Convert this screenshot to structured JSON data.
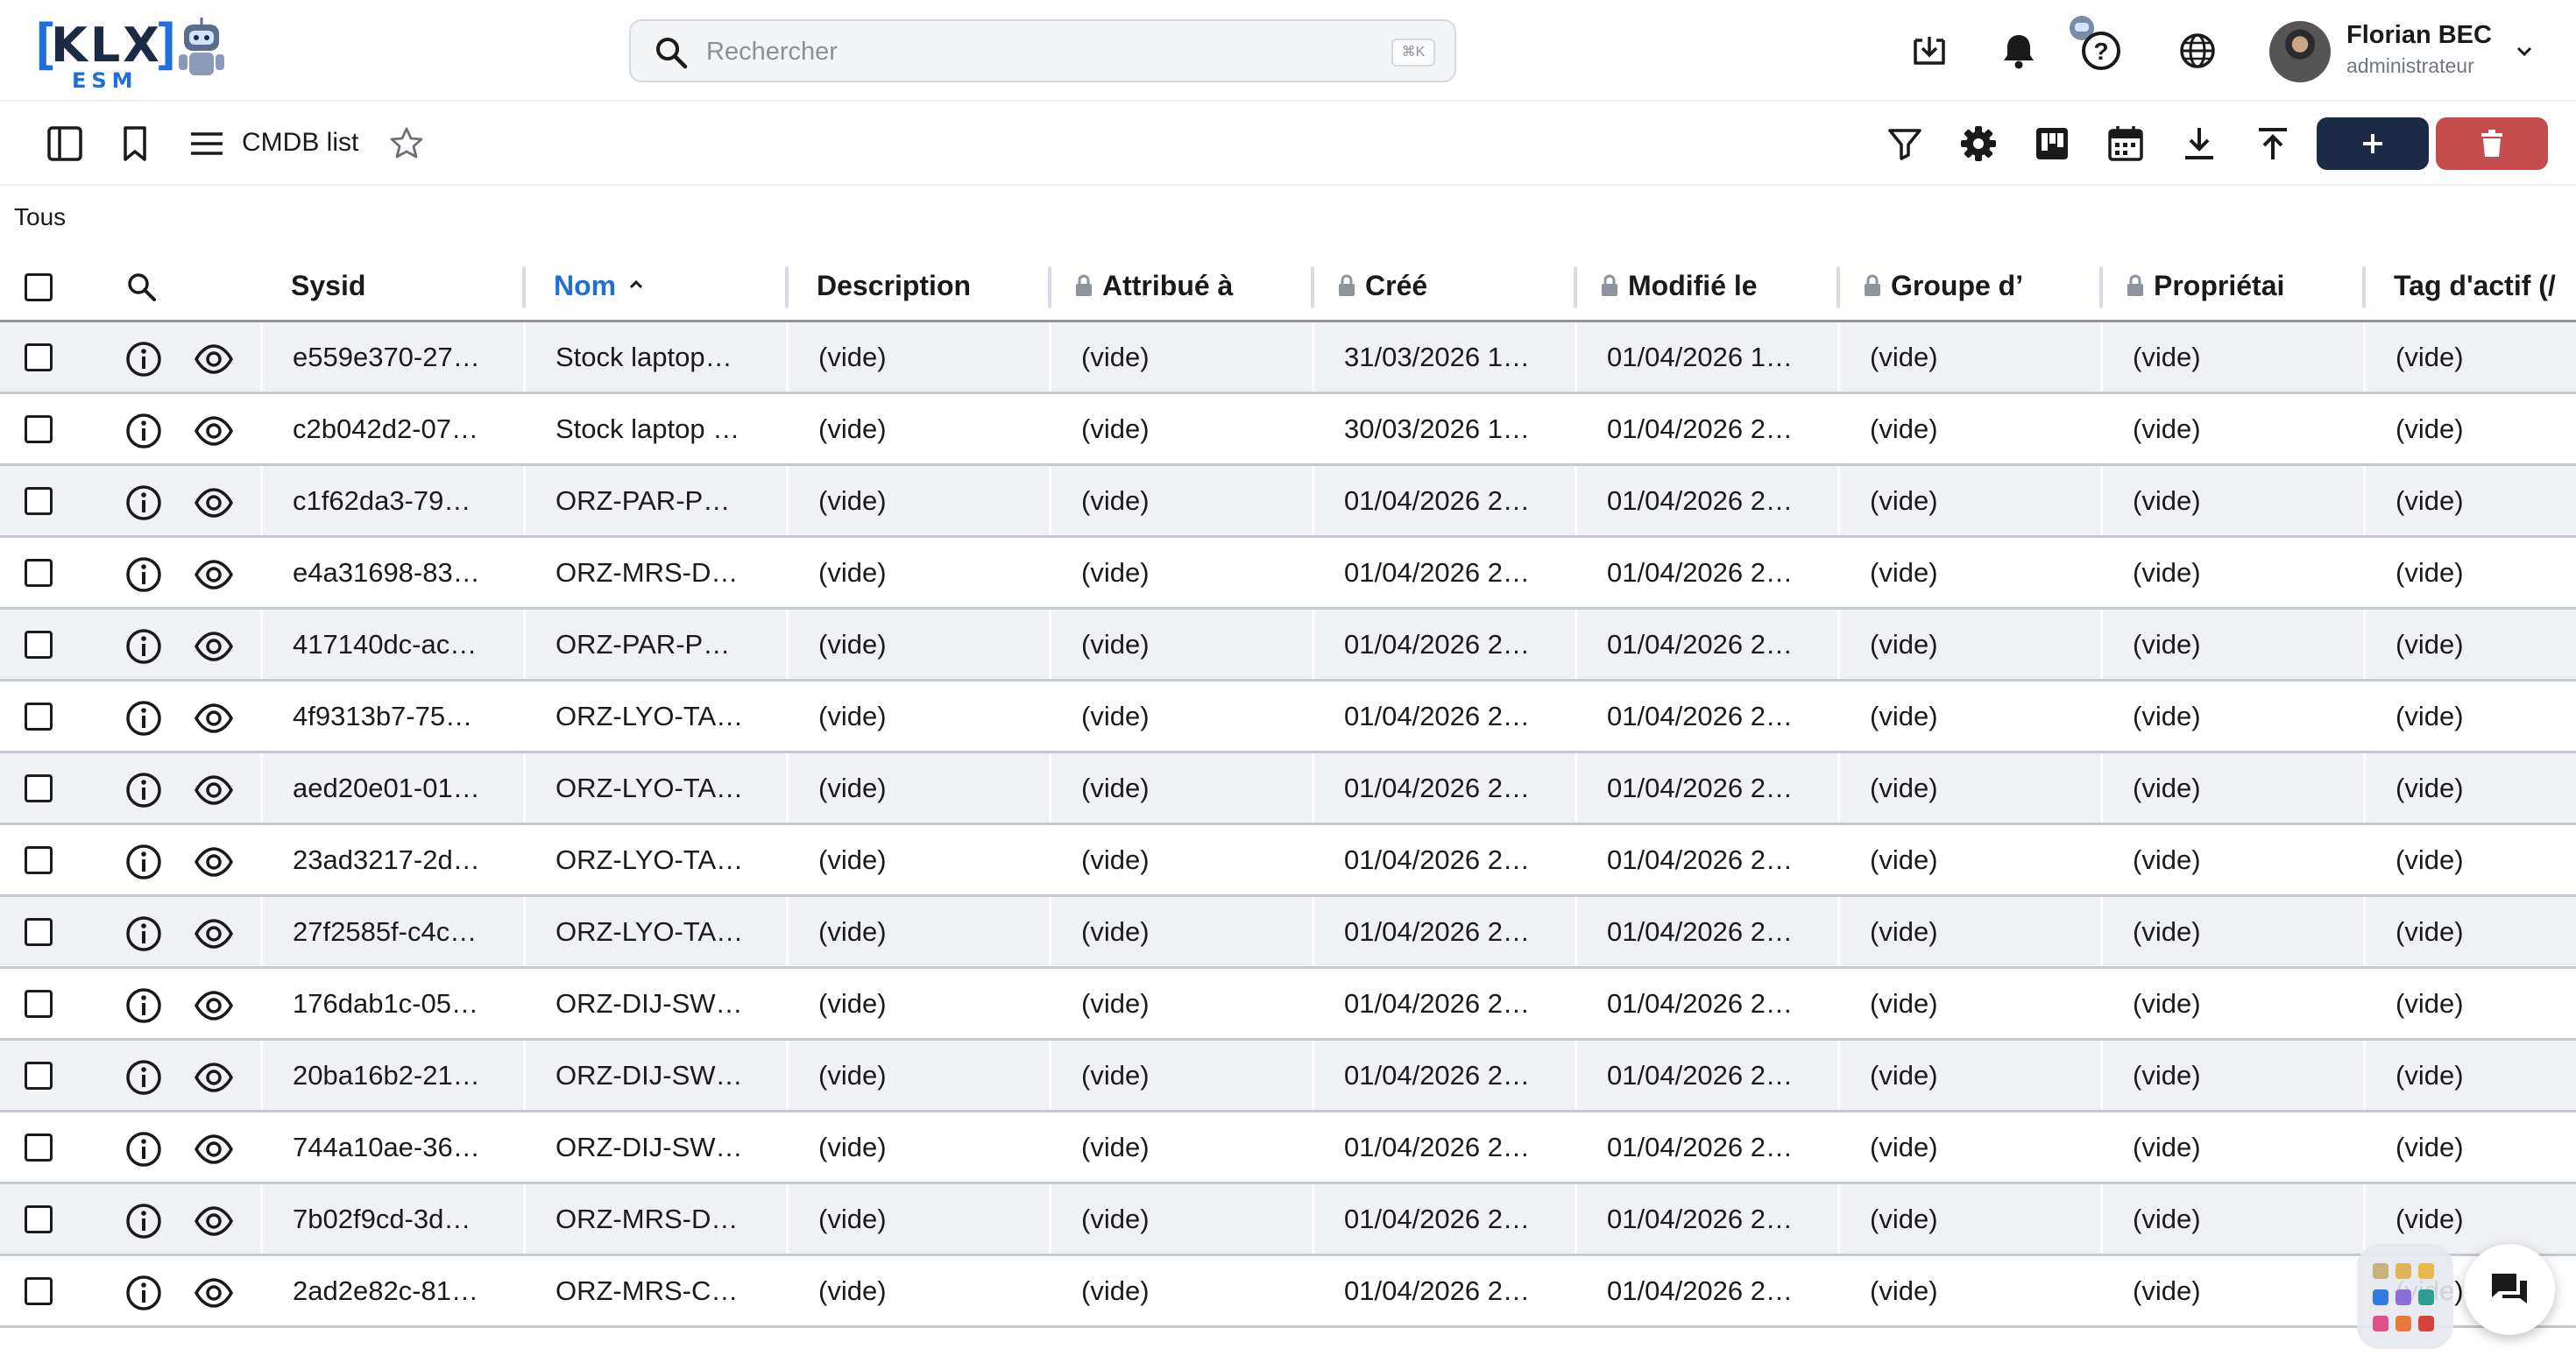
{
  "header": {
    "logo_brand": "KLX",
    "logo_sub": "ESM",
    "search_placeholder": "Rechercher",
    "search_shortcut": "⌘K",
    "user_name": "Florian BEC",
    "user_role": "administrateur"
  },
  "toolbar": {
    "title": "CMDB list",
    "add_label": "+",
    "icons": [
      "sidebar-toggle-icon",
      "bookmark-icon",
      "menu-icon",
      "star-icon",
      "filter-icon",
      "gear-icon",
      "kanban-icon",
      "calendar-icon",
      "download-icon",
      "upload-icon",
      "trash-icon"
    ]
  },
  "filter": {
    "label": "Tous"
  },
  "table": {
    "columns": [
      {
        "key": "sysid",
        "label": "Sysid",
        "locked": false,
        "sorted": false
      },
      {
        "key": "nom",
        "label": "Nom",
        "locked": false,
        "sorted": true
      },
      {
        "key": "description",
        "label": "Description",
        "locked": false,
        "sorted": false
      },
      {
        "key": "attribue",
        "label": "Attribué à",
        "locked": true,
        "sorted": false
      },
      {
        "key": "cree",
        "label": "Créé",
        "locked": true,
        "sorted": false
      },
      {
        "key": "modifie",
        "label": "Modifié le",
        "locked": true,
        "sorted": false
      },
      {
        "key": "groupe",
        "label": "Groupe d’",
        "locked": true,
        "sorted": false
      },
      {
        "key": "proprietaire",
        "label": "Propriétai",
        "locked": true,
        "sorted": false
      },
      {
        "key": "tag",
        "label": "Tag d'actif (/",
        "locked": false,
        "sorted": false
      }
    ],
    "rows": [
      [
        "e559e370-27…",
        "Stock laptop…",
        "(vide)",
        "(vide)",
        "31/03/2026 1…",
        "01/04/2026 1…",
        "(vide)",
        "(vide)",
        "(vide)"
      ],
      [
        "c2b042d2-07…",
        "Stock laptop …",
        "(vide)",
        "(vide)",
        "30/03/2026 1…",
        "01/04/2026 2…",
        "(vide)",
        "(vide)",
        "(vide)"
      ],
      [
        "c1f62da3-79…",
        "ORZ-PAR-P…",
        "(vide)",
        "(vide)",
        "01/04/2026 2…",
        "01/04/2026 2…",
        "(vide)",
        "(vide)",
        "(vide)"
      ],
      [
        "e4a31698-83…",
        "ORZ-MRS-D…",
        "(vide)",
        "(vide)",
        "01/04/2026 2…",
        "01/04/2026 2…",
        "(vide)",
        "(vide)",
        "(vide)"
      ],
      [
        "417140dc-ac…",
        "ORZ-PAR-P…",
        "(vide)",
        "(vide)",
        "01/04/2026 2…",
        "01/04/2026 2…",
        "(vide)",
        "(vide)",
        "(vide)"
      ],
      [
        "4f9313b7-75…",
        "ORZ-LYO-TA…",
        "(vide)",
        "(vide)",
        "01/04/2026 2…",
        "01/04/2026 2…",
        "(vide)",
        "(vide)",
        "(vide)"
      ],
      [
        "aed20e01-01…",
        "ORZ-LYO-TA…",
        "(vide)",
        "(vide)",
        "01/04/2026 2…",
        "01/04/2026 2…",
        "(vide)",
        "(vide)",
        "(vide)"
      ],
      [
        "23ad3217-2d…",
        "ORZ-LYO-TA…",
        "(vide)",
        "(vide)",
        "01/04/2026 2…",
        "01/04/2026 2…",
        "(vide)",
        "(vide)",
        "(vide)"
      ],
      [
        "27f2585f-c4c…",
        "ORZ-LYO-TA…",
        "(vide)",
        "(vide)",
        "01/04/2026 2…",
        "01/04/2026 2…",
        "(vide)",
        "(vide)",
        "(vide)"
      ],
      [
        "176dab1c-05…",
        "ORZ-DIJ-SW…",
        "(vide)",
        "(vide)",
        "01/04/2026 2…",
        "01/04/2026 2…",
        "(vide)",
        "(vide)",
        "(vide)"
      ],
      [
        "20ba16b2-21…",
        "ORZ-DIJ-SW…",
        "(vide)",
        "(vide)",
        "01/04/2026 2…",
        "01/04/2026 2…",
        "(vide)",
        "(vide)",
        "(vide)"
      ],
      [
        "744a10ae-36…",
        "ORZ-DIJ-SW…",
        "(vide)",
        "(vide)",
        "01/04/2026 2…",
        "01/04/2026 2…",
        "(vide)",
        "(vide)",
        "(vide)"
      ],
      [
        "7b02f9cd-3d…",
        "ORZ-MRS-D…",
        "(vide)",
        "(vide)",
        "01/04/2026 2…",
        "01/04/2026 2…",
        "(vide)",
        "(vide)",
        "(vide)"
      ],
      [
        "2ad2e82c-81…",
        "ORZ-MRS-C…",
        "(vide)",
        "(vide)",
        "01/04/2026 2…",
        "01/04/2026 2…",
        "(vide)",
        "(vide)",
        "(vide)"
      ]
    ]
  },
  "colors": {
    "accent": "#1e6fd9",
    "primary_button": "#1b2b45",
    "danger_button": "#c64d4d",
    "row_alt": "#f0f1f4"
  }
}
